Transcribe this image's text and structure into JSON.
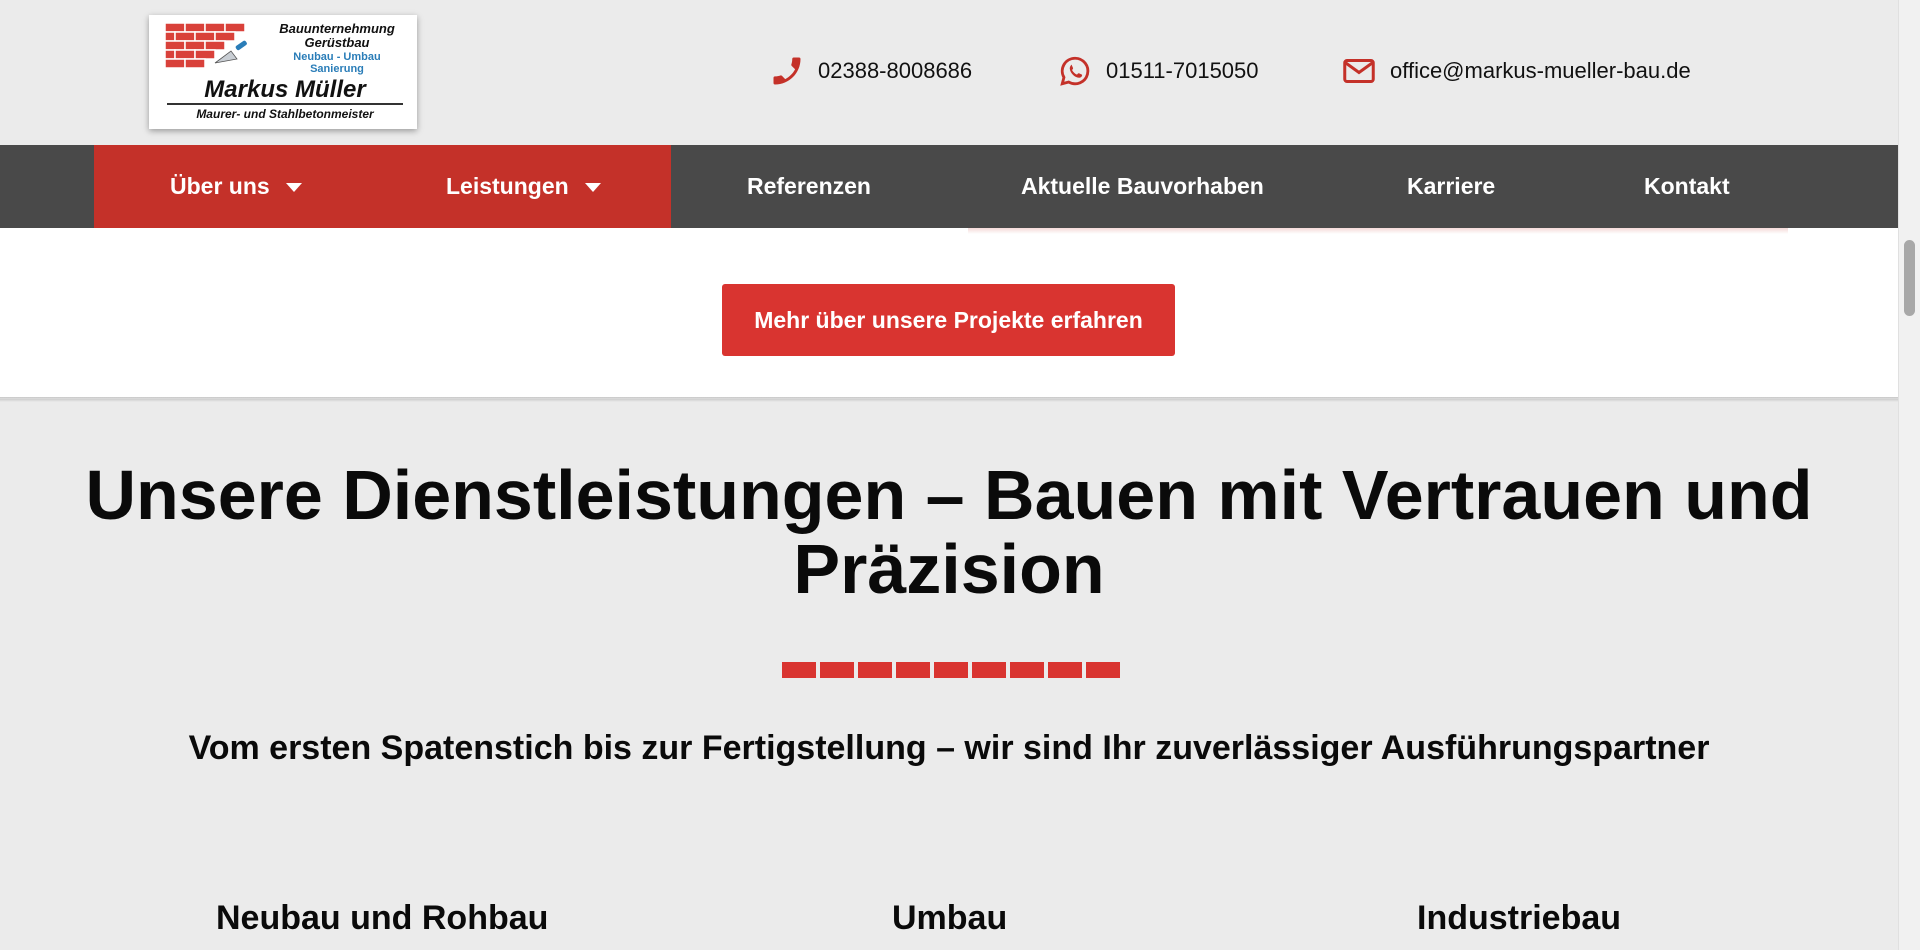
{
  "logo": {
    "line1": "Bauunternehmung",
    "line2": "Gerüstbau",
    "line3": "Neubau - Umbau",
    "line4": "Sanierung",
    "name": "Markus Müller",
    "tagline": "Maurer- und Stahlbetonmeister"
  },
  "contacts": {
    "phone": {
      "icon": "phone-icon",
      "text": "02388-8008686"
    },
    "whatsapp": {
      "icon": "whatsapp-icon",
      "text": "01511-7015050"
    },
    "email": {
      "icon": "envelope-icon",
      "text": "office@markus-mueller-bau.de"
    }
  },
  "nav": {
    "items": [
      {
        "label": "Über uns",
        "dropdown": true
      },
      {
        "label": "Leistungen",
        "dropdown": true
      },
      {
        "label": "Referenzen",
        "dropdown": false
      },
      {
        "label": "Aktuelle Bauvorhaben",
        "dropdown": false
      },
      {
        "label": "Karriere",
        "dropdown": false
      },
      {
        "label": "Kontakt",
        "dropdown": false
      }
    ]
  },
  "projects_button": {
    "label": "Mehr über unsere Projekte erfahren"
  },
  "services": {
    "title": "Unsere Dienstleistungen – Bauen mit Vertrauen und Präzision",
    "subtitle": "Vom ersten Spatenstich bis zur Fertigstellung – wir sind Ihr zuverlässiger Ausführungspartner",
    "items": [
      "Neubau und Rohbau",
      "Umbau",
      "Industriebau"
    ]
  },
  "colors": {
    "brand_red": "#d93430",
    "nav_red": "#c43129",
    "nav_gray": "#494949",
    "page_bg": "#ebebeb"
  }
}
